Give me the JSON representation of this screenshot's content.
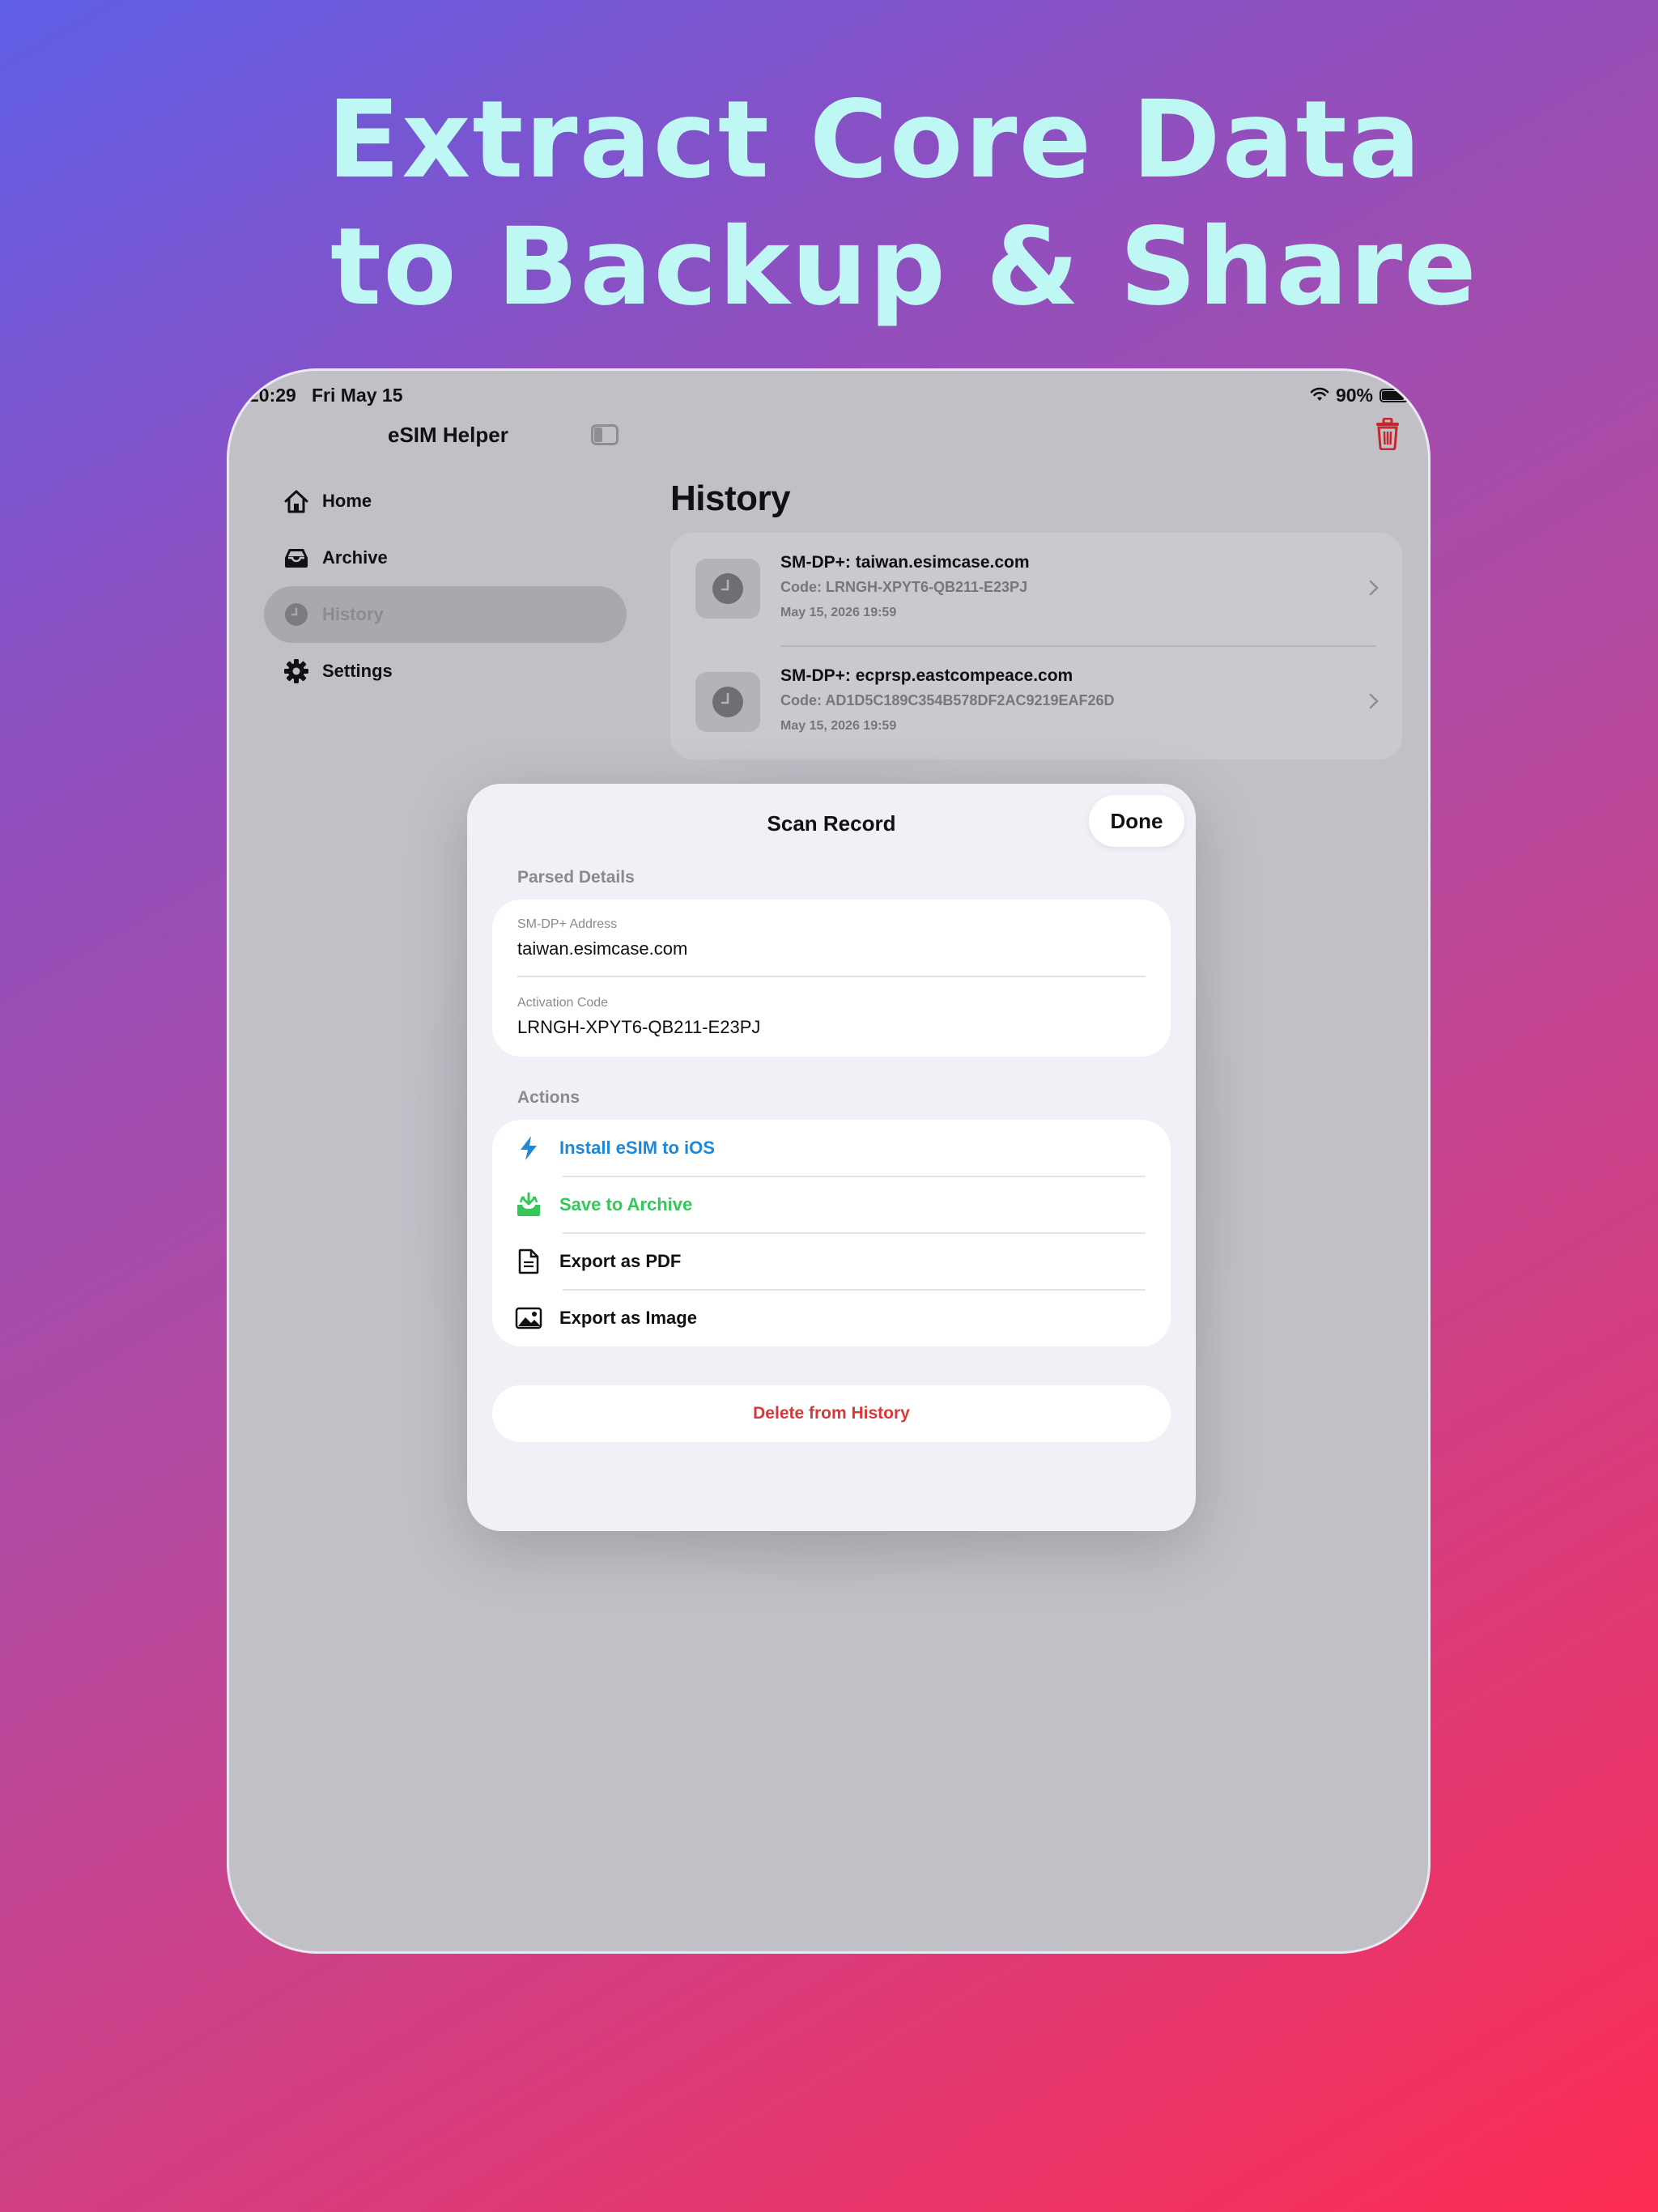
{
  "headline": {
    "line1": "Extract Core Data",
    "line2": "to Backup & Share"
  },
  "status_bar": {
    "time": "20:29",
    "date": "Fri May 15",
    "battery": "90%",
    "battery_level": 0.9
  },
  "sidebar": {
    "app_title": "eSIM Helper",
    "items": [
      {
        "label": "Home",
        "icon": "house-icon"
      },
      {
        "label": "Archive",
        "icon": "tray-icon"
      },
      {
        "label": "History",
        "icon": "clock-icon",
        "selected": true
      },
      {
        "label": "Settings",
        "icon": "gear-icon"
      }
    ]
  },
  "main": {
    "title": "History",
    "history": [
      {
        "title": "SM-DP+: taiwan.esimcase.com",
        "code": "Code: LRNGH-XPYT6-QB211-E23PJ",
        "date": "May 15, 2026 19:59"
      },
      {
        "title": "SM-DP+: ecprsp.eastcompeace.com",
        "code": "Code: AD1D5C189C354B578DF2AC9219EAF26D",
        "date": "May 15, 2026 19:59"
      }
    ]
  },
  "sheet": {
    "title": "Scan Record",
    "done": "Done",
    "parsed_label": "Parsed Details",
    "fields": [
      {
        "label": "SM-DP+ Address",
        "value": "taiwan.esimcase.com"
      },
      {
        "label": "Activation Code",
        "value": "LRNGH-XPYT6-QB211-E23PJ"
      }
    ],
    "actions_label": "Actions",
    "actions": [
      {
        "label": "Install eSIM to iOS",
        "icon": "bolt-icon",
        "color": "#1e88d8"
      },
      {
        "label": "Save to Archive",
        "icon": "tray-download-icon",
        "color": "#34c759"
      },
      {
        "label": "Export as PDF",
        "icon": "document-icon",
        "color": "#111111"
      },
      {
        "label": "Export as Image",
        "icon": "photo-icon",
        "color": "#111111"
      }
    ],
    "delete": "Delete from History"
  },
  "colors": {
    "headline": "#bff7f5",
    "destructive": "#d8383a",
    "accent_blue": "#1e88d8",
    "accent_green": "#34c759"
  }
}
